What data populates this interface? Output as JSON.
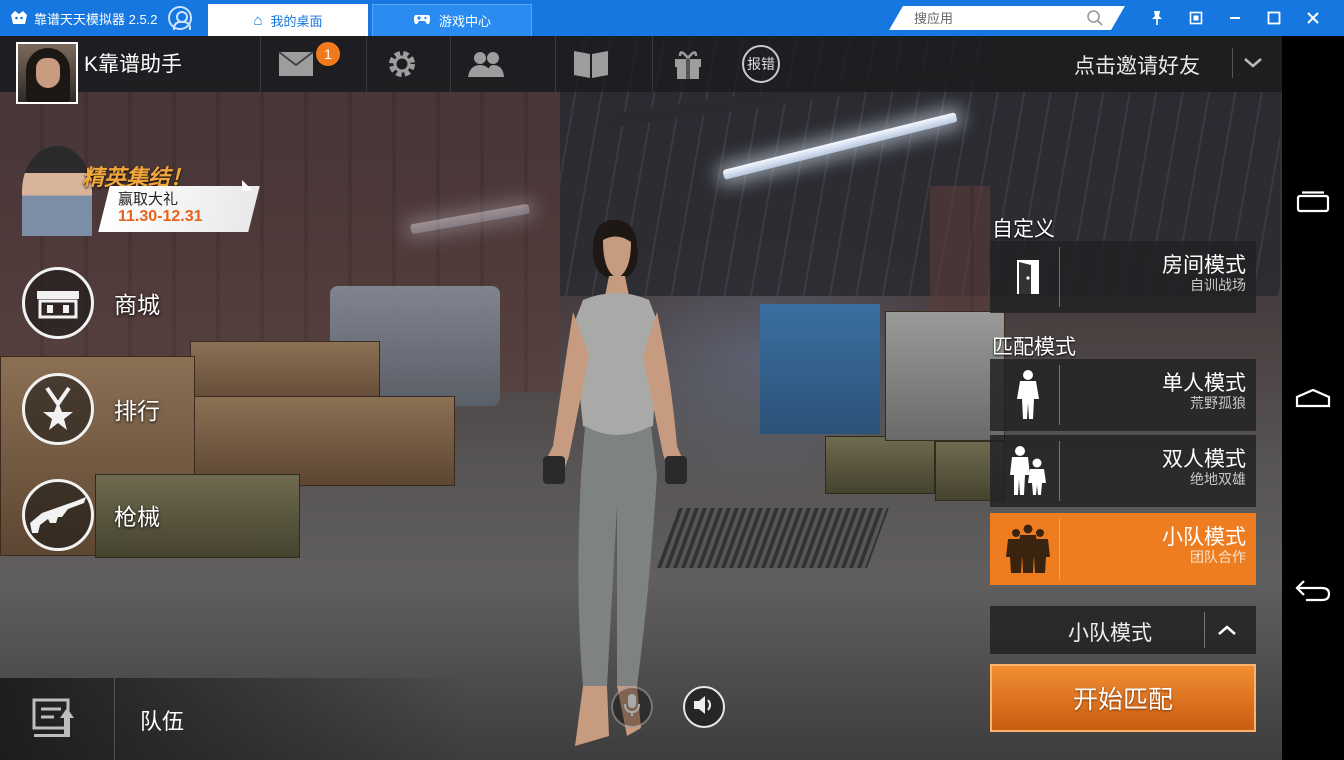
{
  "window": {
    "app_title": "靠谱天天模拟器 2.5.2",
    "tabs": [
      {
        "label": "我的桌面",
        "active": true
      },
      {
        "label": "游戏中心",
        "active": false
      }
    ],
    "search_placeholder": "搜应用",
    "controls": [
      "pin-icon",
      "restore-icon",
      "minimize-icon",
      "maximize-icon",
      "close-icon"
    ]
  },
  "game": {
    "player_name": "K靠谱助手",
    "mail_badge": "1",
    "report_label": "报错",
    "invite_label": "点击邀请好友",
    "event": {
      "title": "精英集结！",
      "subtitle": "赢取大礼",
      "date": "11.30-12.31"
    },
    "left_menu": [
      {
        "label": "商城",
        "icon": "shop-icon"
      },
      {
        "label": "排行",
        "icon": "ranking-icon"
      },
      {
        "label": "枪械",
        "icon": "gun-icon"
      }
    ],
    "custom_section_label": "自定义",
    "room_mode": {
      "title": "房间模式",
      "subtitle": "自训战场"
    },
    "match_section_label": "匹配模式",
    "modes": [
      {
        "title": "单人模式",
        "subtitle": "荒野孤狼",
        "active": false
      },
      {
        "title": "双人模式",
        "subtitle": "绝地双雄",
        "active": false
      },
      {
        "title": "小队模式",
        "subtitle": "团队合作",
        "active": true
      }
    ],
    "selected_mode": "小队模式",
    "start_button": "开始匹配",
    "team_label": "队伍"
  },
  "colors": {
    "titlebar": "#1677e0",
    "accent_orange": "#ee7d21",
    "start_button": "#e2782a"
  }
}
